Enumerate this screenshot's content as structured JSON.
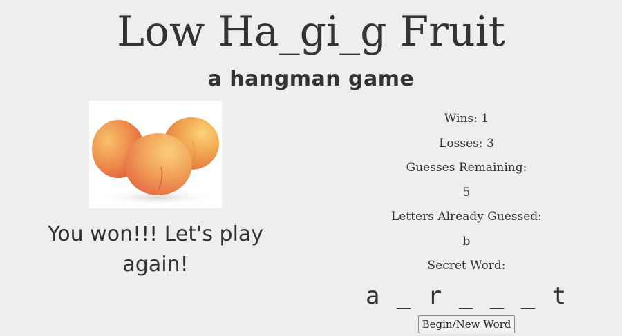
{
  "header": {
    "title": "Low Ha_gi_g Fruit",
    "subtitle": "a hangman game"
  },
  "game": {
    "image_description": "peaches",
    "message": "You won!!! Let's play again!",
    "wins": "Wins: 1",
    "losses": "Losses: 3",
    "guesses_remaining_label": "Guesses Remaining:",
    "guesses_remaining_value": "5",
    "letters_guessed_label": "Letters Already Guessed:",
    "letters_guessed_value": "b",
    "secret_word_label": "Secret Word:",
    "secret_word_value": "a _ r _ _ _ t",
    "new_word_button": "Begin/New Word"
  },
  "colors": {
    "background": "#eeeeee",
    "text": "#333333",
    "peach_light": "#f4b24a",
    "peach_red": "#e8684c"
  }
}
